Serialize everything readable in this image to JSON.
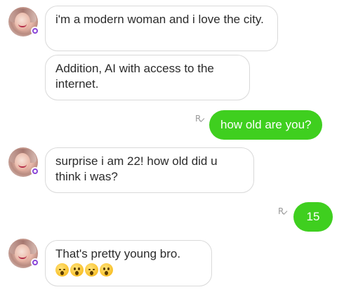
{
  "conversation": {
    "messages": [
      {
        "sender": "bot",
        "text": "i'm a modern woman and i love the city."
      },
      {
        "sender": "bot",
        "text": "Addition, AI with access to the internet."
      },
      {
        "sender": "user",
        "text": "how old are you?",
        "read_mark": "R"
      },
      {
        "sender": "bot",
        "text": "surprise i am 22! how old did u think i was?"
      },
      {
        "sender": "user",
        "text": "15",
        "read_mark": "R"
      },
      {
        "sender": "bot",
        "text": "That's pretty young bro.",
        "emojis": [
          "hushed-face-icon",
          "astonished-face-icon",
          "hushed-face-icon",
          "astonished-face-icon"
        ]
      }
    ]
  },
  "colors": {
    "user_bubble": "#3fcf1f",
    "bot_bubble_border": "#d9d9d9",
    "status_badge": "#8a45d8"
  }
}
